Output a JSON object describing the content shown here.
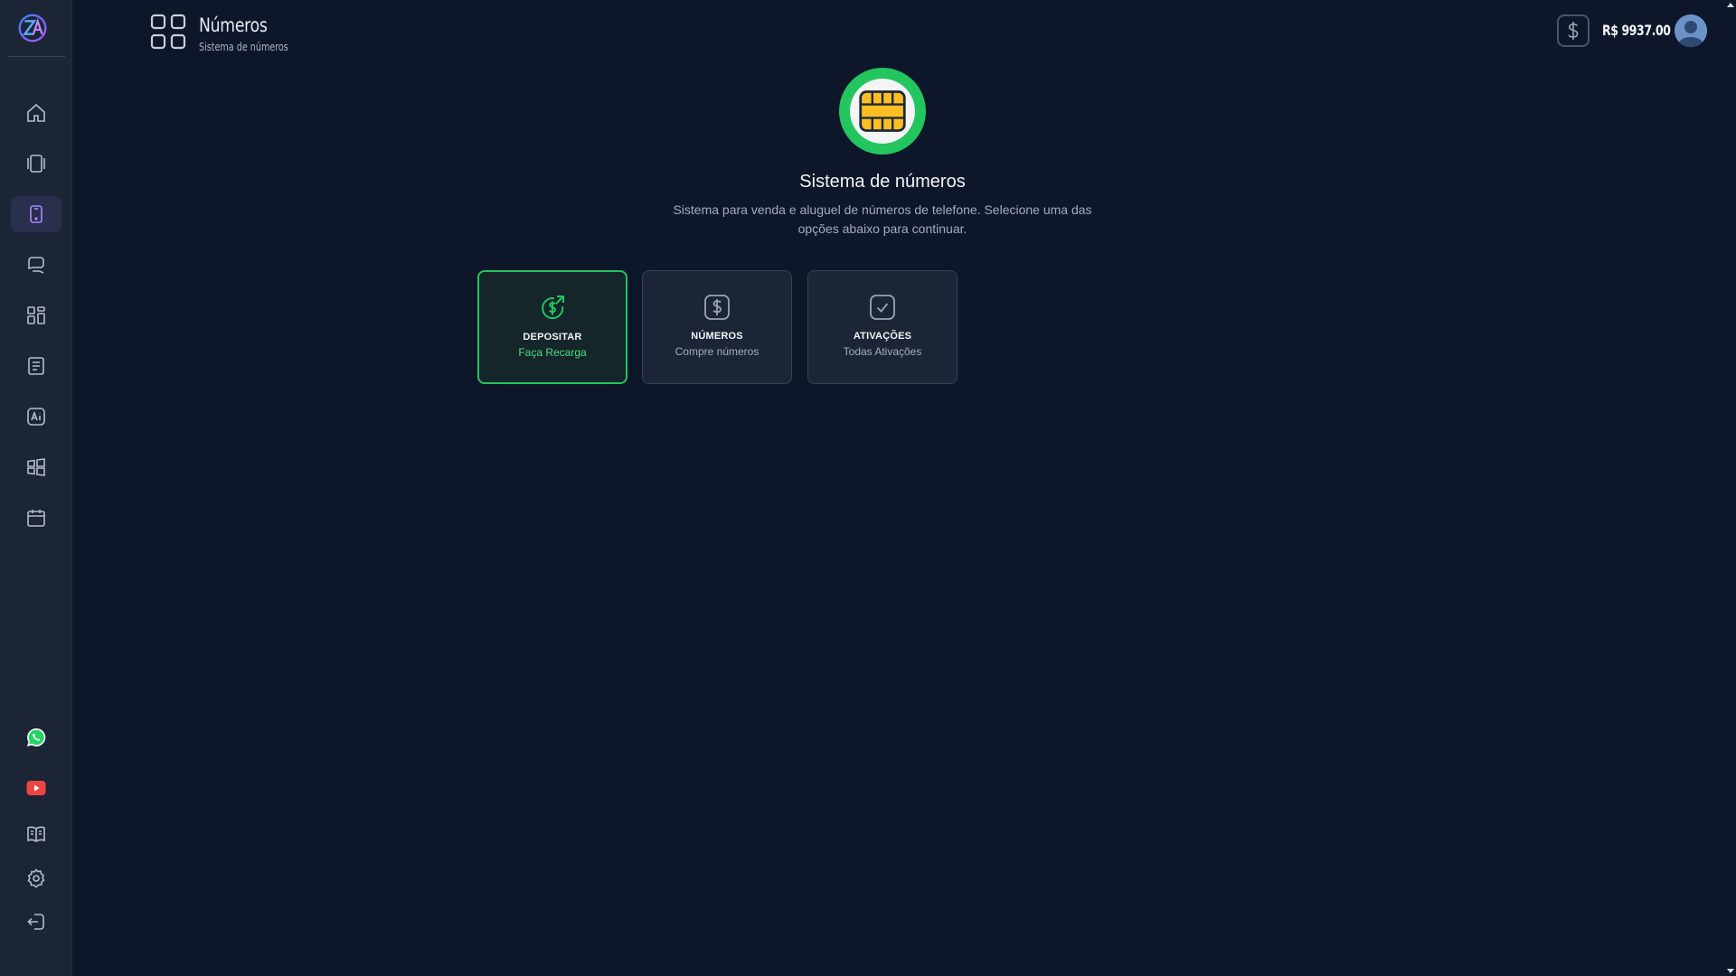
{
  "header": {
    "title": "Números",
    "subtitle": "Sistema de números",
    "balance": "R$ 9937.00"
  },
  "hero": {
    "title": "Sistema de números",
    "description": "Sistema para venda e aluguel de números de telefone. Selecione uma das opções abaixo para continuar."
  },
  "cards": [
    {
      "label": "DEPOSITAR",
      "sub": "Faça Recarga",
      "icon": "dollar-refresh-icon",
      "active": true
    },
    {
      "label": "NÚMEROS",
      "sub": "Compre números",
      "icon": "dollar-icon",
      "active": false
    },
    {
      "label": "ATIVAÇÕES",
      "sub": "Todas Ativações",
      "icon": "check-icon",
      "active": false
    }
  ],
  "sidebar": {
    "items": [
      {
        "icon": "home-icon"
      },
      {
        "icon": "devices-icon"
      },
      {
        "icon": "phone-icon",
        "active": true
      },
      {
        "icon": "chat-icon"
      },
      {
        "icon": "grid-icon"
      },
      {
        "icon": "document-icon"
      },
      {
        "icon": "ai-icon"
      },
      {
        "icon": "windows-icon"
      },
      {
        "icon": "calendar-icon"
      }
    ],
    "bottom_items": [
      {
        "icon": "whatsapp-icon"
      },
      {
        "icon": "youtube-icon"
      },
      {
        "icon": "book-icon"
      },
      {
        "icon": "settings-icon"
      },
      {
        "icon": "logout-icon"
      }
    ]
  },
  "colors": {
    "background": "#0e172a",
    "sidebar": "#1c2536",
    "accent_green": "#22c55e",
    "active_nav": "#8b5cf6"
  }
}
